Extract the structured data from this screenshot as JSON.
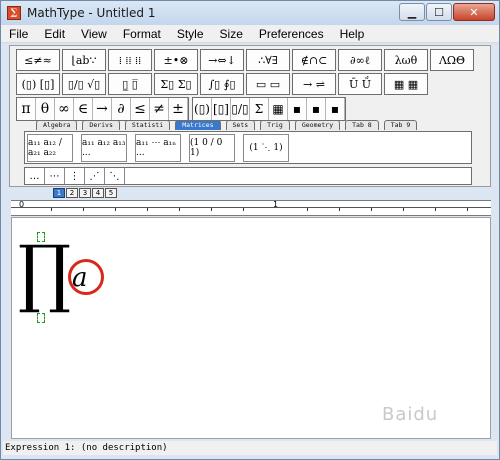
{
  "window": {
    "title": "MathType - Untitled 1"
  },
  "menu": [
    "File",
    "Edit",
    "View",
    "Format",
    "Style",
    "Size",
    "Preferences",
    "Help"
  ],
  "toolbar": {
    "row1": [
      "≤≠≈",
      "⌊ab∵",
      "⁞ ⁞⁞ ⁞⁞",
      "±•⊗",
      "→⇔↓",
      "∴∀∃",
      "∉∩⊂",
      "∂∞ℓ",
      "λωθ",
      "ΛΩΘ"
    ],
    "row2": [
      "(▯) [▯]",
      "▯/▯ √▯",
      "▯̲ ▯̅",
      "Σ▯ Σ▯",
      "∫▯ ∮▯",
      "▭ ▭",
      "→ ⇌",
      "Ū Ṹ",
      "▦ ▦"
    ],
    "row3": [
      "π",
      "θ",
      "∞",
      "∈",
      "→",
      "∂",
      "≤",
      "≠",
      "±",
      "(▯)",
      "[▯]",
      "▯/▯",
      "Σ",
      "▦",
      "▪",
      "▪",
      "▪"
    ]
  },
  "tabs": [
    {
      "label": "Algebra",
      "active": false
    },
    {
      "label": "Derivs",
      "active": false
    },
    {
      "label": "Statisti",
      "active": false
    },
    {
      "label": "Matrices",
      "active": true
    },
    {
      "label": "Sets",
      "active": false
    },
    {
      "label": "Trig",
      "active": false
    },
    {
      "label": "Geometry",
      "active": false
    },
    {
      "label": "Tab 8",
      "active": false
    },
    {
      "label": "Tab 9",
      "active": false
    }
  ],
  "templates": [
    "a₁₁ a₁₂ / a₂₁ a₂₂",
    "a₁₁ a₁₂ a₁₃ ...",
    "a₁₁ ⋯ a₁ₙ ...",
    "(1 0 / 0 1)",
    "(1 ⋱ 1)"
  ],
  "small_row": [
    "…",
    "⋯",
    "⋮",
    "⋰",
    "⋱"
  ],
  "size_buttons": [
    "1",
    "2",
    "3",
    "4",
    "5"
  ],
  "ruler": {
    "marks": [
      "0",
      "1"
    ]
  },
  "editor": {
    "operator": "∏",
    "variable": "a"
  },
  "status": {
    "text": "Expression 1:  (no description)"
  },
  "watermark": "Baidu"
}
